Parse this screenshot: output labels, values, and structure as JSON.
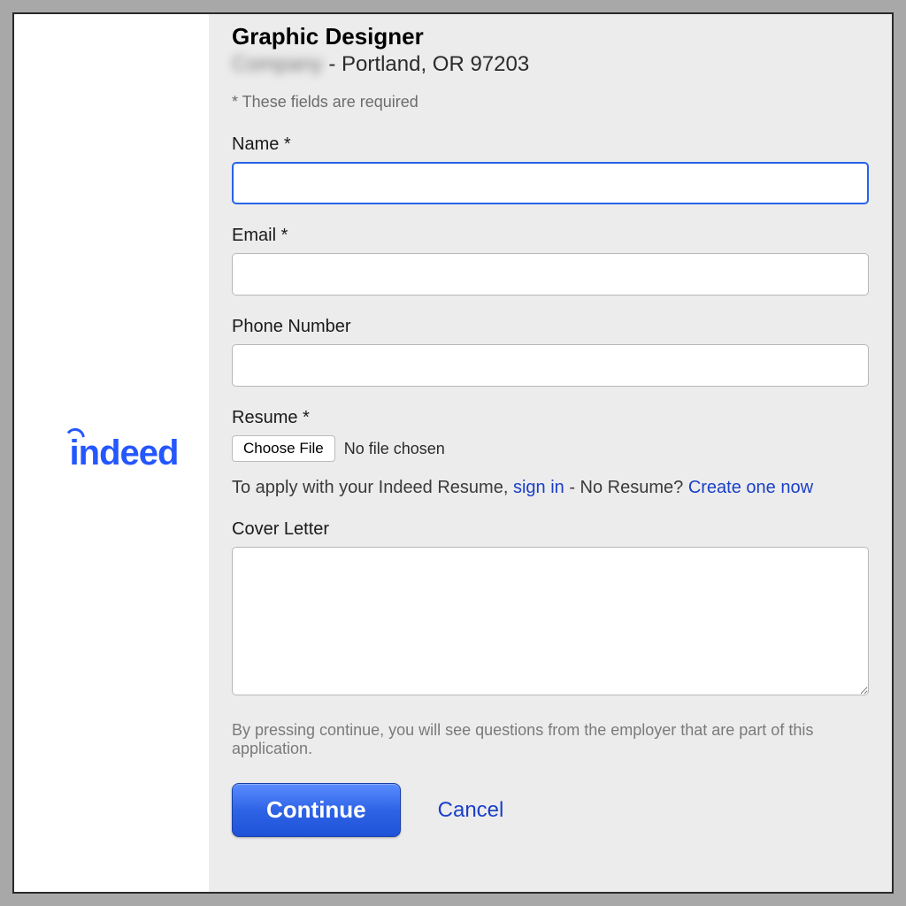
{
  "logo": {
    "text": "indeed"
  },
  "header": {
    "job_title": "Graphic Designer",
    "company_blurred": "Company",
    "location_separator": " - ",
    "location": "Portland, OR 97203"
  },
  "required_note": "* These fields are required",
  "fields": {
    "name": {
      "label": "Name *",
      "value": ""
    },
    "email": {
      "label": "Email *",
      "value": ""
    },
    "phone": {
      "label": "Phone Number",
      "value": ""
    },
    "resume": {
      "label": "Resume *",
      "choose_file_label": "Choose File",
      "no_file_text": "No file chosen",
      "help_prefix": "To apply with your Indeed Resume, ",
      "sign_in": "sign in",
      "help_mid": " - No Resume? ",
      "create_now": "Create one now"
    },
    "cover_letter": {
      "label": "Cover Letter",
      "value": ""
    }
  },
  "disclaimer": "By pressing continue, you will see questions from the employer that are part of this application.",
  "buttons": {
    "continue": "Continue",
    "cancel": "Cancel"
  }
}
